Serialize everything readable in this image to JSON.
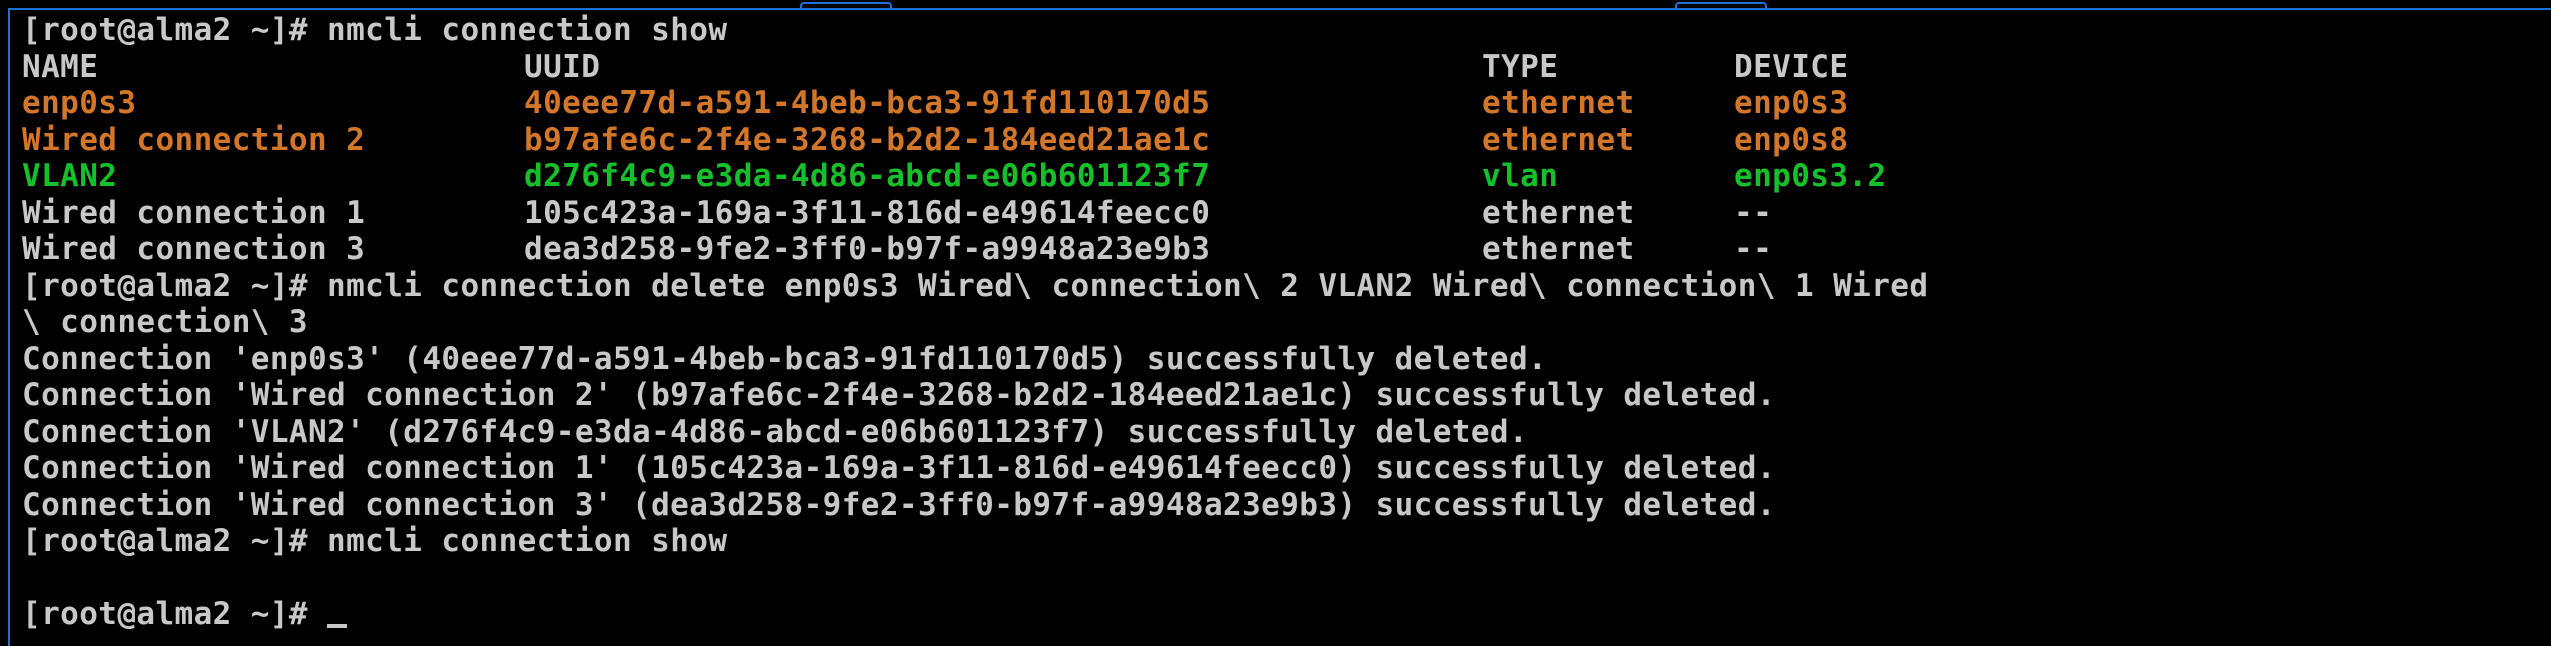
{
  "colors": {
    "background": "#000000",
    "text": "#c8c8c8",
    "orange": "#d2762a",
    "green": "#16c02a",
    "frame": "#1f6fd8"
  },
  "prompt": "[root@alma2 ~]#",
  "cmd1": "nmcli connection show",
  "table": {
    "headers": {
      "name": "NAME",
      "uuid": "UUID",
      "type": "TYPE",
      "device": "DEVICE"
    },
    "rows": [
      {
        "name": "enp0s3",
        "uuid": "40eee77d-a591-4beb-bca3-91fd110170d5",
        "type": "ethernet",
        "device": "enp0s3",
        "color": "orange"
      },
      {
        "name": "Wired connection 2",
        "uuid": "b97afe6c-2f4e-3268-b2d2-184eed21ae1c",
        "type": "ethernet",
        "device": "enp0s8",
        "color": "orange"
      },
      {
        "name": "VLAN2",
        "uuid": "d276f4c9-e3da-4d86-abcd-e06b601123f7",
        "type": "vlan",
        "device": "enp0s3.2",
        "color": "green"
      },
      {
        "name": "Wired connection 1",
        "uuid": "105c423a-169a-3f11-816d-e49614feecc0",
        "type": "ethernet",
        "device": "--",
        "color": "white"
      },
      {
        "name": "Wired connection 3",
        "uuid": "dea3d258-9fe2-3ff0-b97f-a9948a23e9b3",
        "type": "ethernet",
        "device": "--",
        "color": "white"
      }
    ]
  },
  "cmd2_line1": "nmcli connection delete enp0s3 Wired\\ connection\\ 2 VLAN2 Wired\\ connection\\ 1 Wired",
  "cmd2_line2": "\\ connection\\ 3",
  "output": [
    "Connection 'enp0s3' (40eee77d-a591-4beb-bca3-91fd110170d5) successfully deleted.",
    "Connection 'Wired connection 2' (b97afe6c-2f4e-3268-b2d2-184eed21ae1c) successfully deleted.",
    "Connection 'VLAN2' (d276f4c9-e3da-4d86-abcd-e06b601123f7) successfully deleted.",
    "Connection 'Wired connection 1' (105c423a-169a-3f11-816d-e49614feecc0) successfully deleted.",
    "Connection 'Wired connection 3' (dea3d258-9fe2-3ff0-b97f-a9948a23e9b3) successfully deleted."
  ],
  "cmd3": "nmcli connection show"
}
